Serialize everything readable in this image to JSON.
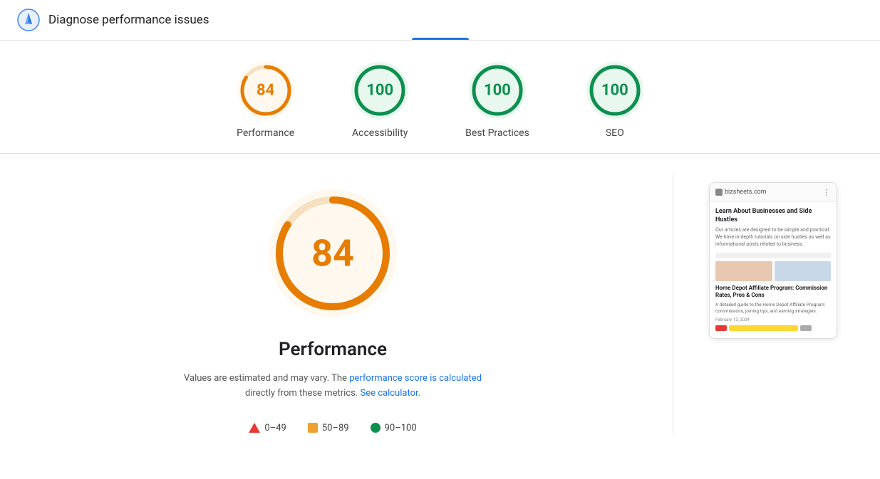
{
  "header": {
    "icon_label": "lighthouse-icon",
    "title": "Diagnose performance issues",
    "tab_active": true
  },
  "scores": [
    {
      "id": "performance",
      "value": 84,
      "label": "Performance",
      "type": "orange",
      "arc_pct": 84
    },
    {
      "id": "accessibility",
      "value": 100,
      "label": "Accessibility",
      "type": "green",
      "arc_pct": 100
    },
    {
      "id": "best-practices",
      "value": 100,
      "label": "Best Practices",
      "type": "green",
      "arc_pct": 100
    },
    {
      "id": "seo",
      "value": 100,
      "label": "SEO",
      "type": "green",
      "arc_pct": 100
    }
  ],
  "main": {
    "big_score": 84,
    "big_score_label": "Performance",
    "description_before": "Values are estimated and may vary. The",
    "description_link1": "performance score is calculated",
    "description_middle": "directly from these metrics.",
    "description_link2": "See calculator",
    "description_end": "."
  },
  "legend": [
    {
      "range": "0–49",
      "color": "red",
      "shape": "triangle"
    },
    {
      "range": "50–89",
      "color": "orange",
      "shape": "square"
    },
    {
      "range": "90–100",
      "color": "green",
      "shape": "circle"
    }
  ],
  "preview": {
    "url": "bizsheets.com",
    "site_title": "Learn About Businesses and Side Hustles",
    "site_desc": "Our articles are designed to be simple and practical. We have in-depth tutorials on side hustles as well as informational posts related to business.",
    "article_title": "Home Depot Affiliate Program: Commission Rates, Pros & Cons",
    "article_desc": "A detailed guide to the Home Depot Affiliate Program: commissions, joining tips, and earning strategies.",
    "article_date": "February 13, 2024"
  }
}
